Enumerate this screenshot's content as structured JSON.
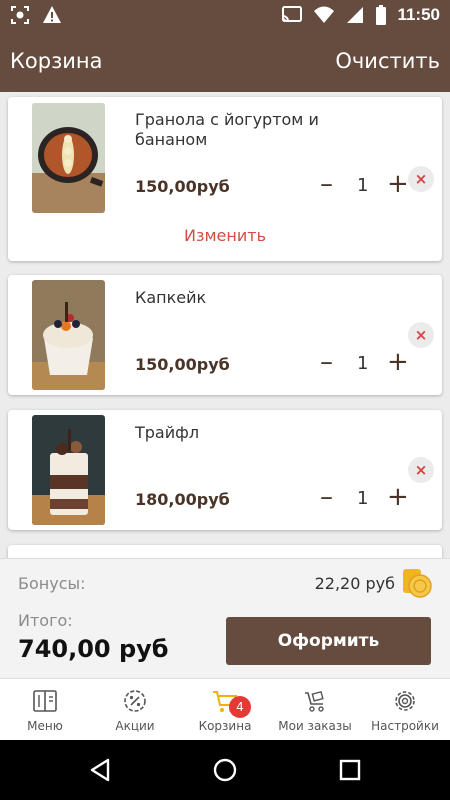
{
  "status_bar": {
    "time": "11:50",
    "icons": [
      "screenshot-icon",
      "warning-icon",
      "cast-icon",
      "wifi-icon",
      "signal-icon",
      "battery-icon"
    ]
  },
  "app_bar": {
    "title": "Корзина",
    "action_label": "Очистить"
  },
  "cart": {
    "items": [
      {
        "name": "Гранола с йогуртом и бананом",
        "price": "150,00руб",
        "quantity": "1",
        "remove_label": "×",
        "change_label": "Изменить",
        "image": "granola-photo"
      },
      {
        "name": "Капкейк",
        "price": "150,00руб",
        "quantity": "1",
        "remove_label": "×",
        "image": "cupcake-photo"
      },
      {
        "name": "Трайфл",
        "price": "180,00руб",
        "quantity": "1",
        "remove_label": "×",
        "image": "trifle-photo"
      }
    ],
    "qty_minus": "–",
    "qty_plus": "+"
  },
  "summary": {
    "bonus_label": "Бонусы:",
    "bonus_value": "22,20 руб",
    "total_label": "Итого:",
    "total_value": "740,00 руб",
    "checkout_label": "Оформить"
  },
  "bottom_nav": {
    "items": [
      {
        "label": "Меню",
        "icon": "menu-book-icon"
      },
      {
        "label": "Акции",
        "icon": "percent-badge-icon"
      },
      {
        "label": "Корзина",
        "icon": "cart-icon",
        "badge": "4"
      },
      {
        "label": "Мои заказы",
        "icon": "orders-cart-icon"
      },
      {
        "label": "Настройки",
        "icon": "gear-icon"
      }
    ]
  },
  "colors": {
    "brand": "#654c3f",
    "remove": "#d94040",
    "change_link": "#d24d42",
    "badge": "#e53935",
    "coin": "#f4b324",
    "cart_active": "#f0b400"
  }
}
